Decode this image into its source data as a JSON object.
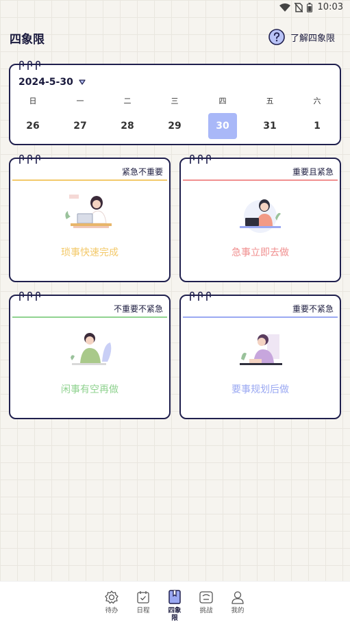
{
  "status_bar": {
    "time": "10:03"
  },
  "header": {
    "title": "四象限",
    "help_label": "了解四象限"
  },
  "calendar": {
    "current_date": "2024-5-30",
    "weekdays": [
      "日",
      "一",
      "二",
      "三",
      "四",
      "五",
      "六"
    ],
    "dates": [
      "26",
      "27",
      "28",
      "29",
      "30",
      "31",
      "1"
    ],
    "selected_date": "30"
  },
  "quadrants": [
    {
      "title": "紧急不重要",
      "slogan": "琐事快速完成",
      "color": "#f3c96a"
    },
    {
      "title": "重要且紧急",
      "slogan": "急事立即去做",
      "color": "#f08f8f"
    },
    {
      "title": "不重要不紧急",
      "slogan": "闲事有空再做",
      "color": "#8fd28f"
    },
    {
      "title": "重要不紧急",
      "slogan": "要事规划后做",
      "color": "#9aa8f2"
    }
  ],
  "nav": {
    "items": [
      {
        "label": "待办",
        "icon": "gear-icon"
      },
      {
        "label": "日程",
        "icon": "calendar-check-icon"
      },
      {
        "label": "四象限",
        "icon": "bookmark-icon"
      },
      {
        "label": "挑战",
        "icon": "challenge-icon"
      },
      {
        "label": "我的",
        "icon": "user-icon"
      }
    ],
    "active": "四象限",
    "accent": "#1f1f4d"
  }
}
